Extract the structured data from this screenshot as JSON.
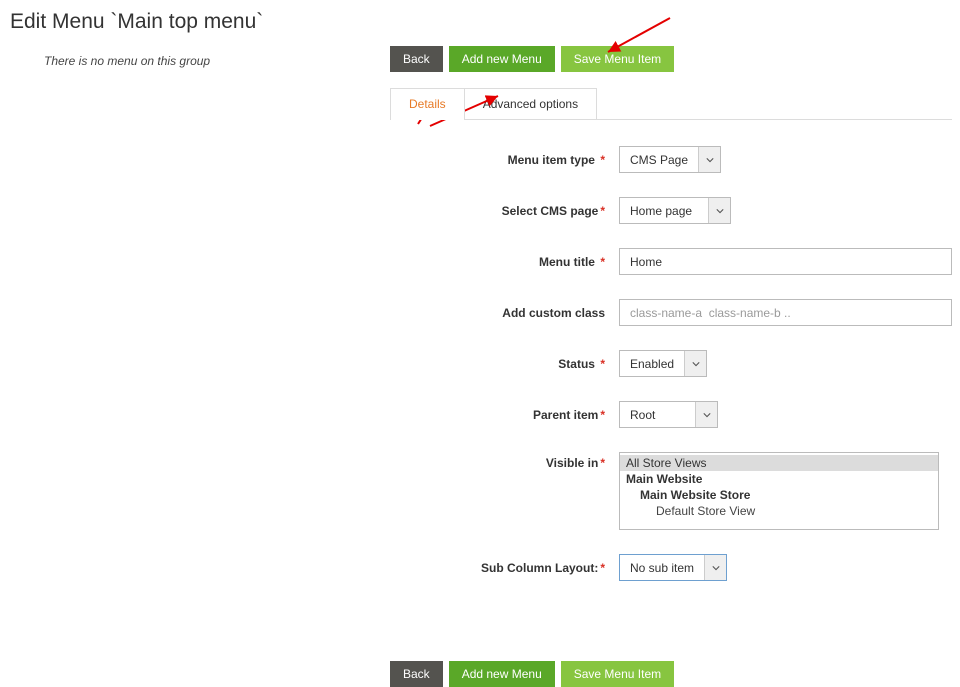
{
  "page_title": "Edit Menu `Main top menu`",
  "left": {
    "empty_msg": "There is no menu on this group"
  },
  "buttons": {
    "back": "Back",
    "add_new": "Add new Menu",
    "save": "Save Menu Item"
  },
  "tabs": {
    "details": "Details",
    "advanced": "Advanced options"
  },
  "form": {
    "menu_item_type": {
      "label": "Menu item type",
      "value": "CMS Page"
    },
    "select_cms_page": {
      "label": "Select CMS page",
      "value": "Home page"
    },
    "menu_title": {
      "label": "Menu title",
      "value": "Home"
    },
    "custom_class": {
      "label": "Add custom class",
      "placeholder": "class-name-a  class-name-b .."
    },
    "status": {
      "label": "Status",
      "value": "Enabled"
    },
    "parent_item": {
      "label": "Parent item",
      "value": "Root"
    },
    "visible_in": {
      "label": "Visible in",
      "options": {
        "all": "All Store Views",
        "main_website": "Main Website",
        "main_store": "Main Website Store",
        "default_view": "Default Store View"
      }
    },
    "sub_column": {
      "label": "Sub Column Layout:",
      "value": "No sub item"
    }
  }
}
